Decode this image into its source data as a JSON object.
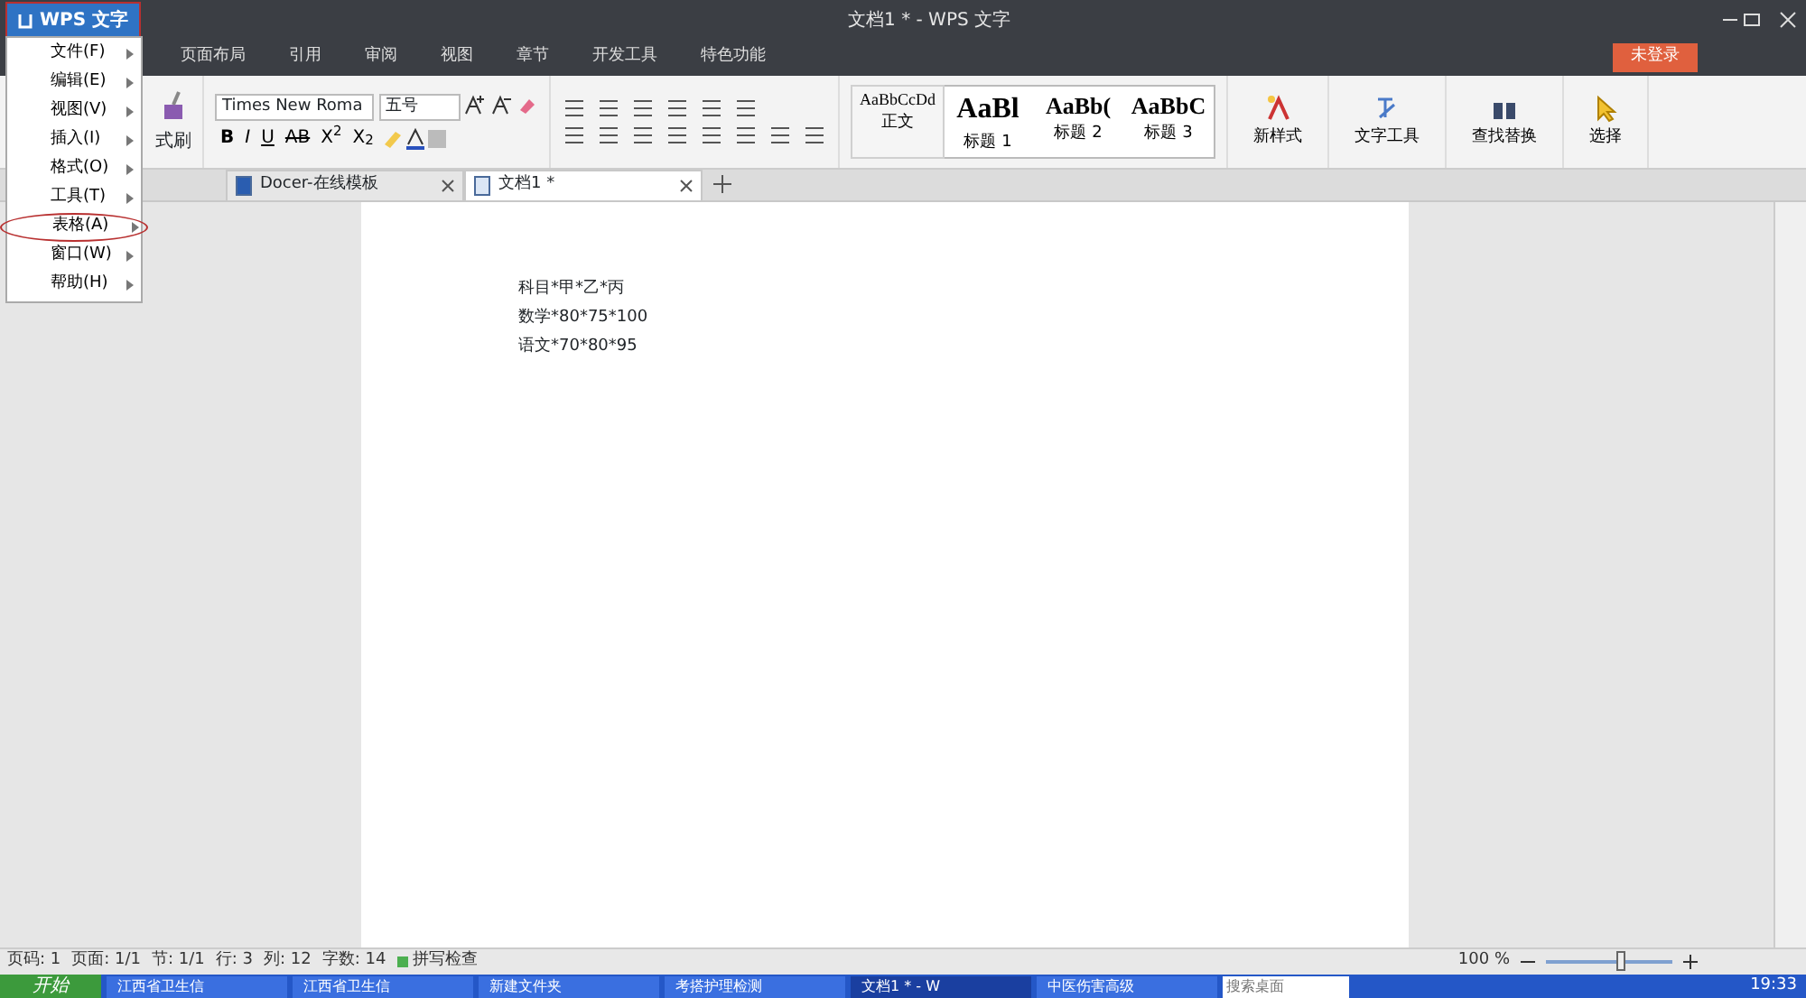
{
  "window": {
    "app_button": {
      "label": "WPS 文字",
      "annotated": true
    },
    "title": "文档1 * - WPS 文字",
    "login_button": "未登录"
  },
  "menu_tabs": [
    "页面布局",
    "引用",
    "审阅",
    "视图",
    "章节",
    "开发工具",
    "特色功能"
  ],
  "app_menu": {
    "items": [
      {
        "label": "文件(F)",
        "annotated": false
      },
      {
        "label": "编辑(E)",
        "annotated": false
      },
      {
        "label": "视图(V)",
        "annotated": false
      },
      {
        "label": "插入(I)",
        "annotated": false
      },
      {
        "label": "格式(O)",
        "annotated": false
      },
      {
        "label": "工具(T)",
        "annotated": false
      },
      {
        "label": "表格(A)",
        "annotated": true
      },
      {
        "label": "窗口(W)",
        "annotated": false
      },
      {
        "label": "帮助(H)",
        "annotated": false
      }
    ]
  },
  "ribbon": {
    "format_painter": "式刷",
    "font_name": "Times New Roma",
    "font_size": "五号",
    "format_buttons": [
      "B",
      "I",
      "U",
      "AB",
      "X$^{2}$",
      "X$_{2}$"
    ],
    "styles": [
      {
        "preview": "AaBbCcDd",
        "label": "正文",
        "selected": true
      },
      {
        "preview": "AaBl",
        "label": "标题 1",
        "selected": false
      },
      {
        "preview": "AaBb(",
        "label": "标题 2",
        "selected": false
      },
      {
        "preview": "AaBbC",
        "label": "标题 3",
        "selected": false
      }
    ],
    "tools": [
      "新样式",
      "文字工具",
      "查找替换",
      "选择"
    ]
  },
  "doc_tabs": [
    {
      "label": "Docer-在线模板",
      "selected": false
    },
    {
      "label": "文档1 *",
      "selected": true
    }
  ],
  "document": {
    "lines": [
      "科目*甲*乙*丙",
      "数学*80*75*100",
      "语文*70*80*95"
    ]
  },
  "status_bar": {
    "items": [
      "页码: 1",
      "页面: 1/1",
      "节: 1/1",
      "行: 3",
      "列: 12",
      "字数: 14"
    ],
    "spell_check": "拼写检查",
    "zoom": "100 %",
    "zoom_slider": {
      "level": 0.6
    }
  },
  "taskbar": {
    "start": "开始",
    "tasks": [
      {
        "label": "江西省卫生信",
        "selected": false
      },
      {
        "label": "江西省卫生信",
        "selected": false
      },
      {
        "label": "新建文件夹",
        "selected": false
      },
      {
        "label": "考搭护理检测",
        "selected": false
      },
      {
        "label": "文档1 * - W",
        "selected": true
      },
      {
        "label": "中医伤害高级",
        "selected": false
      }
    ],
    "search": {
      "placeholder": "搜索桌面"
    },
    "clock": "19:33"
  }
}
